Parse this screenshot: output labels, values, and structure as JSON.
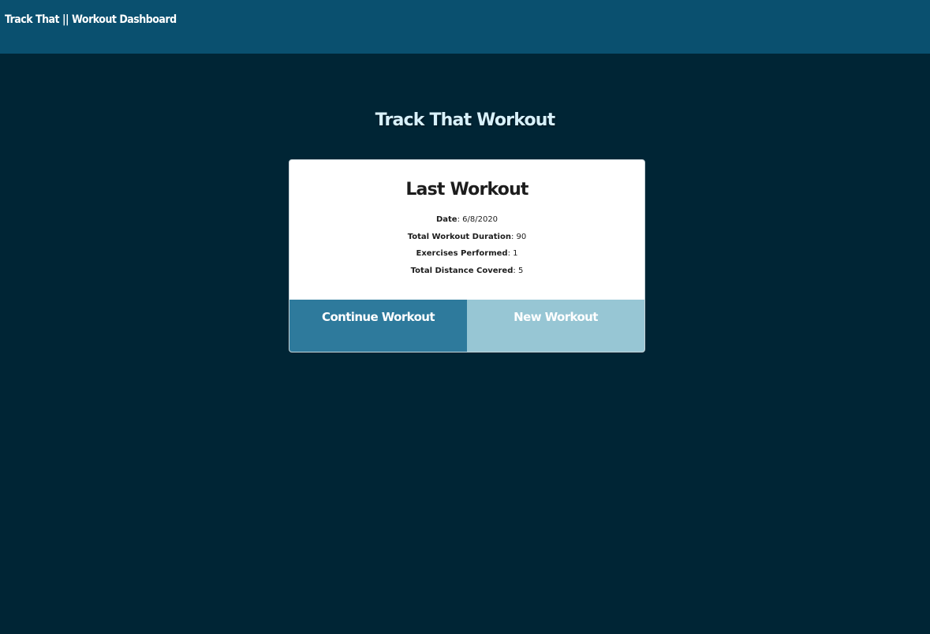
{
  "nav": {
    "brand": "Track That || Workout Dashboard"
  },
  "main": {
    "title": "Track That Workout"
  },
  "card": {
    "title": "Last Workout",
    "stats": [
      {
        "label": "Date",
        "value": "6/8/2020"
      },
      {
        "label": "Total Workout Duration",
        "value": "90"
      },
      {
        "label": "Exercises Performed",
        "value": "1"
      },
      {
        "label": "Total Distance Covered",
        "value": "5"
      }
    ],
    "continue_label": "Continue Workout",
    "new_label": "New Workout"
  },
  "colors": {
    "background": "#002535",
    "navbar": "#0a506f",
    "continue_button": "#2e7a9c",
    "new_button": "#97c6d4"
  }
}
